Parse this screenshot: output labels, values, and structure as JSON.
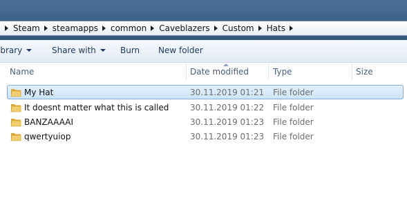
{
  "breadcrumb": {
    "items": [
      "Steam",
      "steamapps",
      "common",
      "Caveblazers",
      "Custom",
      "Hats"
    ]
  },
  "toolbar": {
    "library_label": "ibrary",
    "share_label": "Share with",
    "burn_label": "Burn",
    "new_folder_label": "New folder"
  },
  "columns": {
    "name": "Name",
    "date": "Date modified",
    "type": "Type",
    "size": "Size"
  },
  "files": [
    {
      "name": "My Hat",
      "date": "30.11.2019 01:21",
      "type": "File folder",
      "selected": true
    },
    {
      "name": "It doesnt matter what this is called",
      "date": "30.11.2019 01:22",
      "type": "File folder",
      "selected": false
    },
    {
      "name": "BANZAAAAI",
      "date": "30.11.2019 01:23",
      "type": "File folder",
      "selected": false
    },
    {
      "name": "qwertyuiop",
      "date": "30.11.2019 01:23",
      "type": "File folder",
      "selected": false
    }
  ],
  "colors": {
    "header_bar": "#35577e",
    "selection": "#cde4f9",
    "folder": "#e8c15a"
  }
}
